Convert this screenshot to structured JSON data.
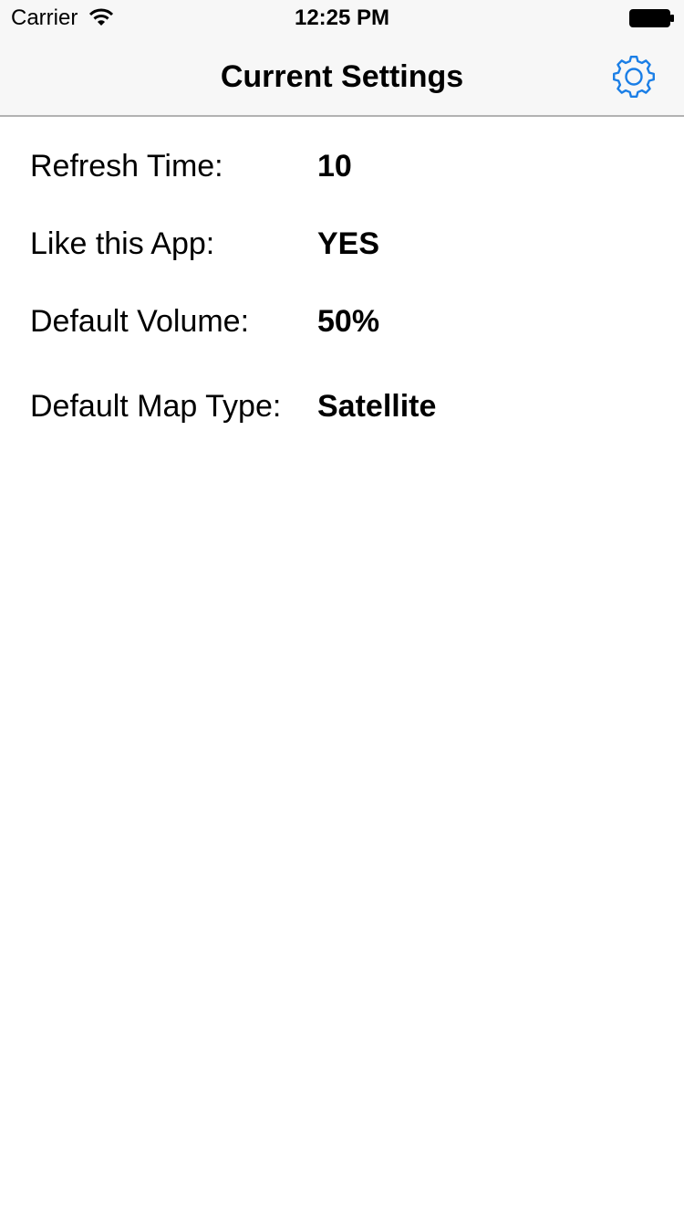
{
  "status_bar": {
    "carrier": "Carrier",
    "time": "12:25 PM",
    "wifi_icon": "wifi-icon",
    "battery_icon": "battery-full-icon"
  },
  "nav_bar": {
    "title": "Current Settings",
    "settings_icon": "gear-icon",
    "accent_color": "#1a7ee6"
  },
  "settings": [
    {
      "label": "Refresh Time:",
      "value": "10"
    },
    {
      "label": "Like this App:",
      "value": "YES"
    },
    {
      "label": "Default Volume:",
      "value": "50%"
    },
    {
      "label": "Default Map Type:",
      "value": "Satellite"
    }
  ]
}
